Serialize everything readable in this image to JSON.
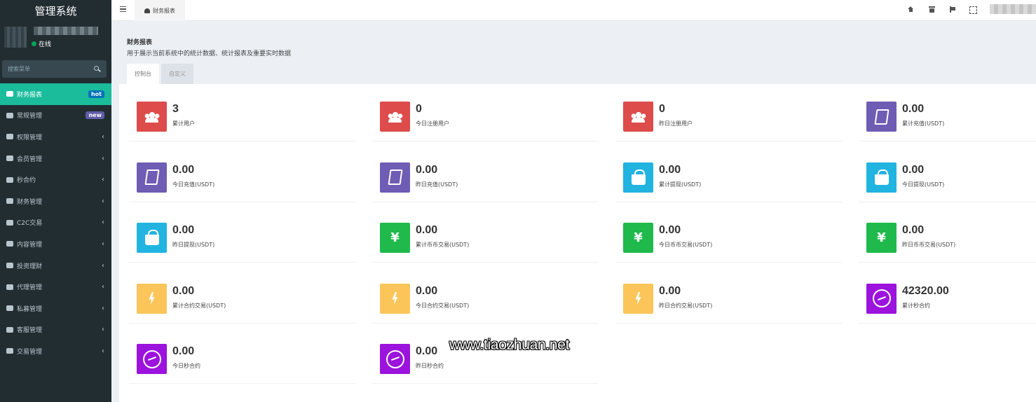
{
  "app": {
    "title": "管理系统"
  },
  "user": {
    "status": "在线"
  },
  "search": {
    "placeholder": "搜索菜单"
  },
  "sidebar": {
    "items": [
      {
        "label": "财务报表",
        "badge": "hot",
        "active": true
      },
      {
        "label": "常规管理",
        "badge": "new"
      },
      {
        "label": "权限管理"
      },
      {
        "label": "会员管理"
      },
      {
        "label": "秒合约"
      },
      {
        "label": "财务管理"
      },
      {
        "label": "C2C交易"
      },
      {
        "label": "内容管理"
      },
      {
        "label": "投资理财"
      },
      {
        "label": "代理管理"
      },
      {
        "label": "私募管理"
      },
      {
        "label": "客服管理"
      },
      {
        "label": "交易管理"
      }
    ]
  },
  "topbar": {
    "tab_label": "财务报表"
  },
  "content": {
    "title": "财务报表",
    "description": "用于展示当前系统中的统计数据、统计报表及重要实时数据",
    "tabs": [
      "控制台",
      "自定义"
    ]
  },
  "stats": [
    {
      "value": "3",
      "label": "累计用户",
      "icon": "users-icon",
      "color": "#dd4b4b"
    },
    {
      "value": "0",
      "label": "今日注册用户",
      "icon": "users-icon",
      "color": "#dd4b4b"
    },
    {
      "value": "0",
      "label": "昨日注册用户",
      "icon": "users-icon",
      "color": "#dd4b4b"
    },
    {
      "value": "0.00",
      "label": "累计充值(USDT)",
      "icon": "book-icon",
      "color": "#6f5cb4"
    },
    {
      "value": "0.00",
      "label": "今日充值(USDT)",
      "icon": "book-icon",
      "color": "#6f5cb4"
    },
    {
      "value": "0.00",
      "label": "昨日充值(USDT)",
      "icon": "book-icon",
      "color": "#6f5cb4"
    },
    {
      "value": "0.00",
      "label": "累计提现(USDT)",
      "icon": "shopping-bag-icon",
      "color": "#21b4e1"
    },
    {
      "value": "0.00",
      "label": "今日提现(USDT)",
      "icon": "shopping-bag-icon",
      "color": "#21b4e1"
    },
    {
      "value": "0.00",
      "label": "昨日提现(USDT)",
      "icon": "shopping-bag-icon",
      "color": "#21b4e1"
    },
    {
      "value": "0.00",
      "label": "累计币币交易(USDT)",
      "icon": "yen-icon",
      "color": "#1fba4b"
    },
    {
      "value": "0.00",
      "label": "今日币币交易(USDT)",
      "icon": "yen-icon",
      "color": "#1fba4b"
    },
    {
      "value": "0.00",
      "label": "昨日币币交易(USDT)",
      "icon": "yen-icon",
      "color": "#1fba4b"
    },
    {
      "value": "0.00",
      "label": "累计合约交易(USDT)",
      "icon": "bolt-icon",
      "color": "#fbc55a"
    },
    {
      "value": "0.00",
      "label": "今日合约交易(USDT)",
      "icon": "bolt-icon",
      "color": "#fbc55a"
    },
    {
      "value": "0.00",
      "label": "昨日合约交易(USDT)",
      "icon": "bolt-icon",
      "color": "#fbc55a"
    },
    {
      "value": "42320.00",
      "label": "累计秒合约",
      "icon": "circle-icon",
      "color": "#9b13dc"
    },
    {
      "value": "0.00",
      "label": "今日秒合约",
      "icon": "circle-icon",
      "color": "#9b13dc"
    },
    {
      "value": "0.00",
      "label": "昨日秒合约",
      "icon": "circle-icon",
      "color": "#9b13dc"
    }
  ],
  "watermark": "www.tiaozhuan.net"
}
